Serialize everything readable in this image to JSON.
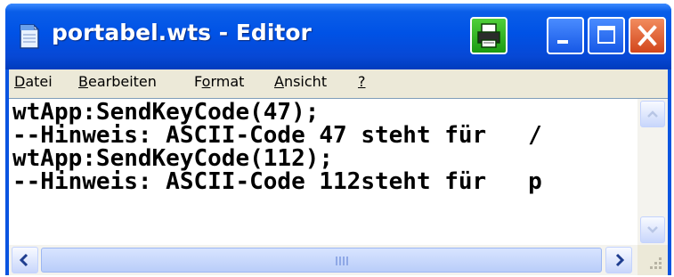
{
  "window": {
    "title": "portabel.wts - Editor"
  },
  "menu": {
    "items": [
      {
        "pre": "",
        "ul": "D",
        "post": "atei"
      },
      {
        "pre": "",
        "ul": "B",
        "post": "earbeiten"
      },
      {
        "pre": "F",
        "ul": "o",
        "post": "rmat"
      },
      {
        "pre": "",
        "ul": "A",
        "post": "nsicht"
      },
      {
        "pre": "",
        "ul": "?",
        "post": ""
      }
    ]
  },
  "editor": {
    "lines": [
      "wtApp:SendKeyCode(47);",
      "--Hinweis: ASCII-Code 47 steht für   /",
      "wtApp:SendKeyCode(112);",
      "--Hinweis: ASCII-Code 112steht für   p"
    ]
  },
  "icons": {
    "app": "notepad-icon",
    "print": "printer-icon",
    "minimize": "minimize-icon",
    "maximize": "maximize-icon",
    "close": "close-icon"
  },
  "colors": {
    "titlebar": "#0052e6",
    "close_button": "#d2461c",
    "print_button": "#1c9a12",
    "client_bg": "#ece9d8"
  }
}
